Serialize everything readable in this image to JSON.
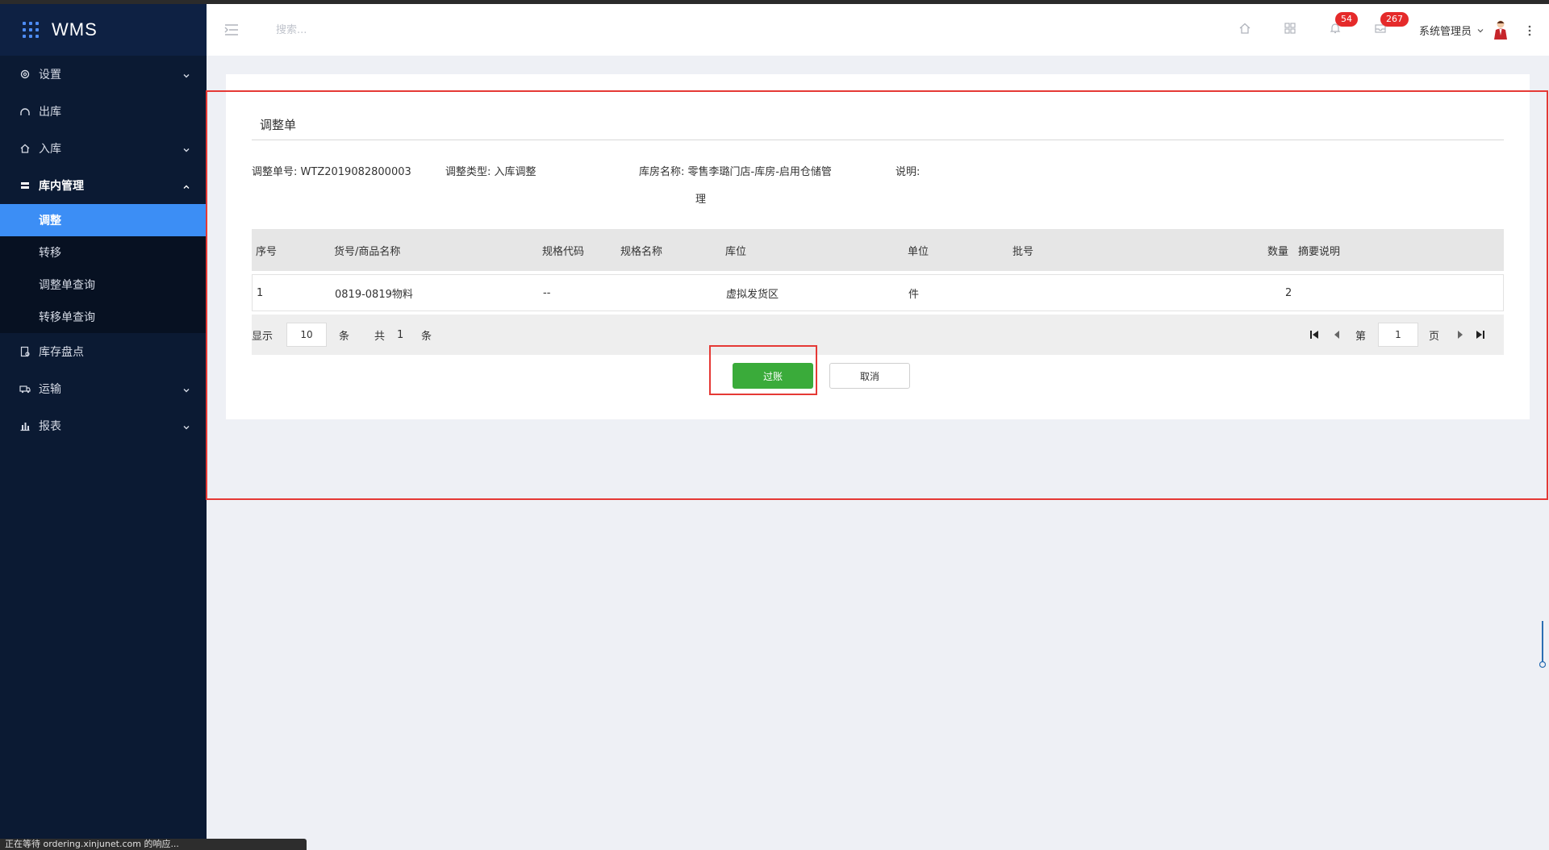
{
  "app": {
    "title": "WMS"
  },
  "sidebar": {
    "items": [
      {
        "label": "设置",
        "icon": "gear-icon",
        "has_caret": true
      },
      {
        "label": "出库",
        "icon": "outbound-icon",
        "has_caret": false
      },
      {
        "label": "入库",
        "icon": "home-icon",
        "has_caret": true
      },
      {
        "label": "库内管理",
        "icon": "inventory-icon",
        "has_caret": true,
        "open": true
      },
      {
        "label": "库存盘点",
        "icon": "stocktake-icon",
        "has_caret": false
      },
      {
        "label": "运输",
        "icon": "truck-icon",
        "has_caret": true
      },
      {
        "label": "报表",
        "icon": "bar-chart-icon",
        "has_caret": true
      }
    ],
    "submenu": [
      {
        "label": "调整",
        "active": true
      },
      {
        "label": "转移",
        "active": false
      },
      {
        "label": "调整单查询",
        "active": false
      },
      {
        "label": "转移单查询",
        "active": false
      }
    ]
  },
  "header": {
    "search_placeholder": "搜索...",
    "bell_badge": "54",
    "mail_badge": "267",
    "user_name": "系统管理员"
  },
  "form": {
    "title": "调整单",
    "fields": {
      "order_no_label": "调整单号:",
      "order_no": "WTZ2019082800003",
      "type_label": "调整类型:",
      "type": "入库调整",
      "warehouse_label": "库房名称:",
      "warehouse_line1": "零售李璐门店-库房-启用仓储管",
      "warehouse_line2": "理",
      "note_label": "说明:"
    },
    "table": {
      "columns": [
        "序号",
        "货号/商品名称",
        "规格代码",
        "规格名称",
        "库位",
        "单位",
        "批号",
        "数量",
        "摘要说明"
      ],
      "rows": [
        {
          "seq": "1",
          "item": "0819-0819物料",
          "spec_code": "--",
          "spec_name": "",
          "location": "虚拟发货区",
          "unit": "件",
          "batch": "",
          "qty": "2",
          "summary": ""
        }
      ]
    },
    "pager": {
      "show_label": "显示",
      "page_size": "10",
      "unit_label": "条",
      "total_label": "共",
      "total": "1",
      "total_unit": "条",
      "page_prefix": "第",
      "page": "1",
      "page_suffix": "页"
    },
    "buttons": {
      "post": "过账",
      "cancel": "取消"
    }
  },
  "status_bar": {
    "text": "正在等待 ordering.xinjunet.com 的响应..."
  },
  "colors": {
    "sidebar_bg": "#0b1a33",
    "active_item": "#3c8ef5",
    "post_button": "#3aab3a",
    "highlight": "#e53935",
    "badge": "#e52a2a"
  }
}
